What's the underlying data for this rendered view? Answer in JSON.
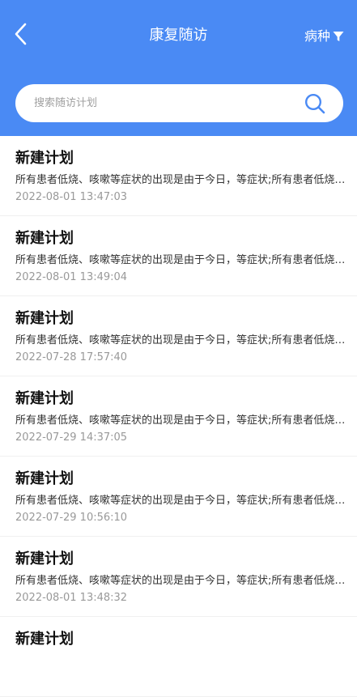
{
  "header": {
    "title": "康复随访",
    "filter_label": "病种"
  },
  "search": {
    "placeholder": "搜索随访计划",
    "value": ""
  },
  "colors": {
    "primary": "#4a8af4",
    "search_icon": "#4a8af4",
    "time_text": "#999999"
  },
  "icons": {
    "back": "chevron-left-icon",
    "filter": "funnel-icon",
    "search": "search-icon"
  },
  "list": [
    {
      "title": "新建计划",
      "desc": "所有患者低烧、咳嗽等症状的出现是由于今日，等症状;所有患者低烧、咳嗽等症状的出现是由于今日",
      "time": "2022-08-01 13:47:03"
    },
    {
      "title": "新建计划",
      "desc": "所有患者低烧、咳嗽等症状的出现是由于今日，等症状;所有患者低烧、咳嗽等症状的出现是由于今日",
      "time": "2022-08-01 13:49:04"
    },
    {
      "title": "新建计划",
      "desc": "所有患者低烧、咳嗽等症状的出现是由于今日，等症状;所有患者低烧、咳嗽等症状的出现是由于今日",
      "time": "2022-07-28 17:57:40"
    },
    {
      "title": "新建计划",
      "desc": "所有患者低烧、咳嗽等症状的出现是由于今日，等症状;所有患者低烧、咳嗽等症状的出现是由于今日",
      "time": "2022-07-29 14:37:05"
    },
    {
      "title": "新建计划",
      "desc": "所有患者低烧、咳嗽等症状的出现是由于今日，等症状;所有患者低烧、咳嗽等症状的出现是由于今日",
      "time": "2022-07-29 10:56:10"
    },
    {
      "title": "新建计划",
      "desc": "所有患者低烧、咳嗽等症状的出现是由于今日，等症状;所有患者低烧、咳嗽等症状的出现是由于今日",
      "time": "2022-08-01 13:48:32"
    },
    {
      "title": "新建计划",
      "desc": "",
      "time": ""
    }
  ]
}
